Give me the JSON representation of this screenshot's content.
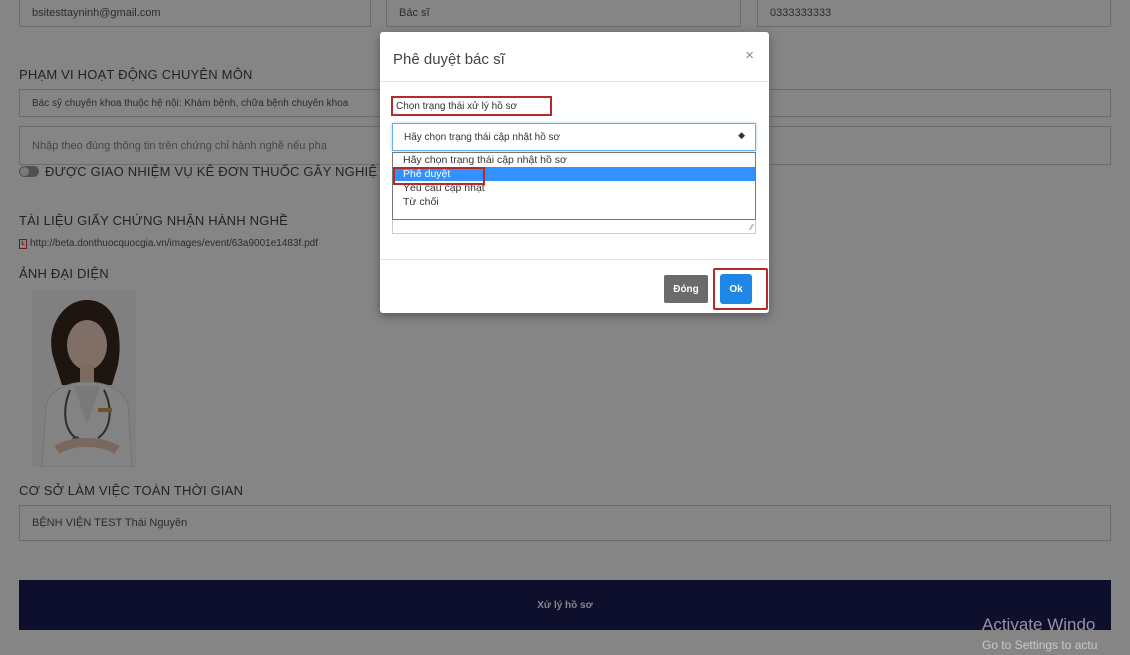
{
  "top_fields": {
    "email": "bsitesttayninh@gmail.com",
    "title": "Bác sĩ",
    "phone": "0333333333"
  },
  "practice_scope": {
    "heading": "PHẠM VI HOẠT ĐỘNG CHUYÊN MÔN",
    "value": "Bác sỹ chuyên khoa thuộc hệ nội: Khám bệnh, chữa bệnh chuyên khoa",
    "placeholder": "Nhập theo đúng thông tin trên chứng chỉ hành nghề nếu phạ"
  },
  "addictive_toggle": {
    "label": "ĐƯỢC GIAO NHIỆM VỤ KÊ ĐƠN THUỐC GÂY NGHIỆ",
    "state": "off"
  },
  "license_docs": {
    "heading": "TÀI LIỆU GIẤY CHỨNG NHẬN HÀNH NGHỀ",
    "file_url": "http://beta.donthuocquocgia.vn/images/event/63a9001e1483f.pdf"
  },
  "avatar": {
    "heading": "ẢNH ĐẠI DIỆN"
  },
  "workplace": {
    "heading": "CƠ SỞ LÀM VIỆC TOÀN THỜI GIAN",
    "value": "BỆNH VIỆN TEST Thái Nguyên"
  },
  "process_button": "Xử lý hồ sơ",
  "watermark": {
    "line1": "Activate Windo",
    "line2": "Go to Settings to actu"
  },
  "modal": {
    "title": "Phê duyệt bác sĩ",
    "close_symbol": "×",
    "status_label": "Chọn trạng thái xử lý hồ sơ",
    "select_value": "Hãy chọn trạng thái cập nhật hồ sơ",
    "options": [
      "Hãy chọn trạng thái cập nhật hồ sơ",
      "Phê duyệt",
      "Yêu cầu cập nhật",
      "Từ chối"
    ],
    "selected_option": "Phê duyệt",
    "close_button": "Đóng",
    "ok_button": "Ok"
  },
  "colors": {
    "primary": "#1e87e5",
    "submit_bar": "#1b1b57",
    "highlight_border": "#b52a2a",
    "option_selected": "#3390ff"
  }
}
